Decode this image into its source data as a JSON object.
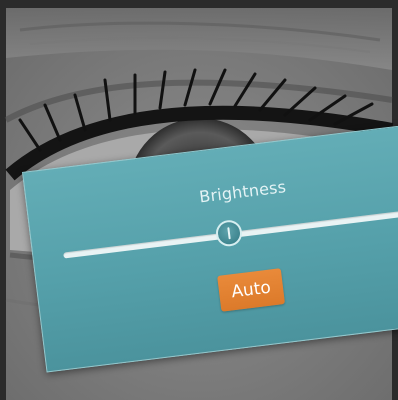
{
  "background": {
    "image": "eye-photo"
  },
  "brightness_panel": {
    "title": "Brightness",
    "slider": {
      "value_fraction": 0.45
    },
    "auto_button_label": "Auto",
    "colors": {
      "panel": "#58a3ad",
      "track": "#e9f3f4",
      "button": "#e4842f"
    }
  }
}
